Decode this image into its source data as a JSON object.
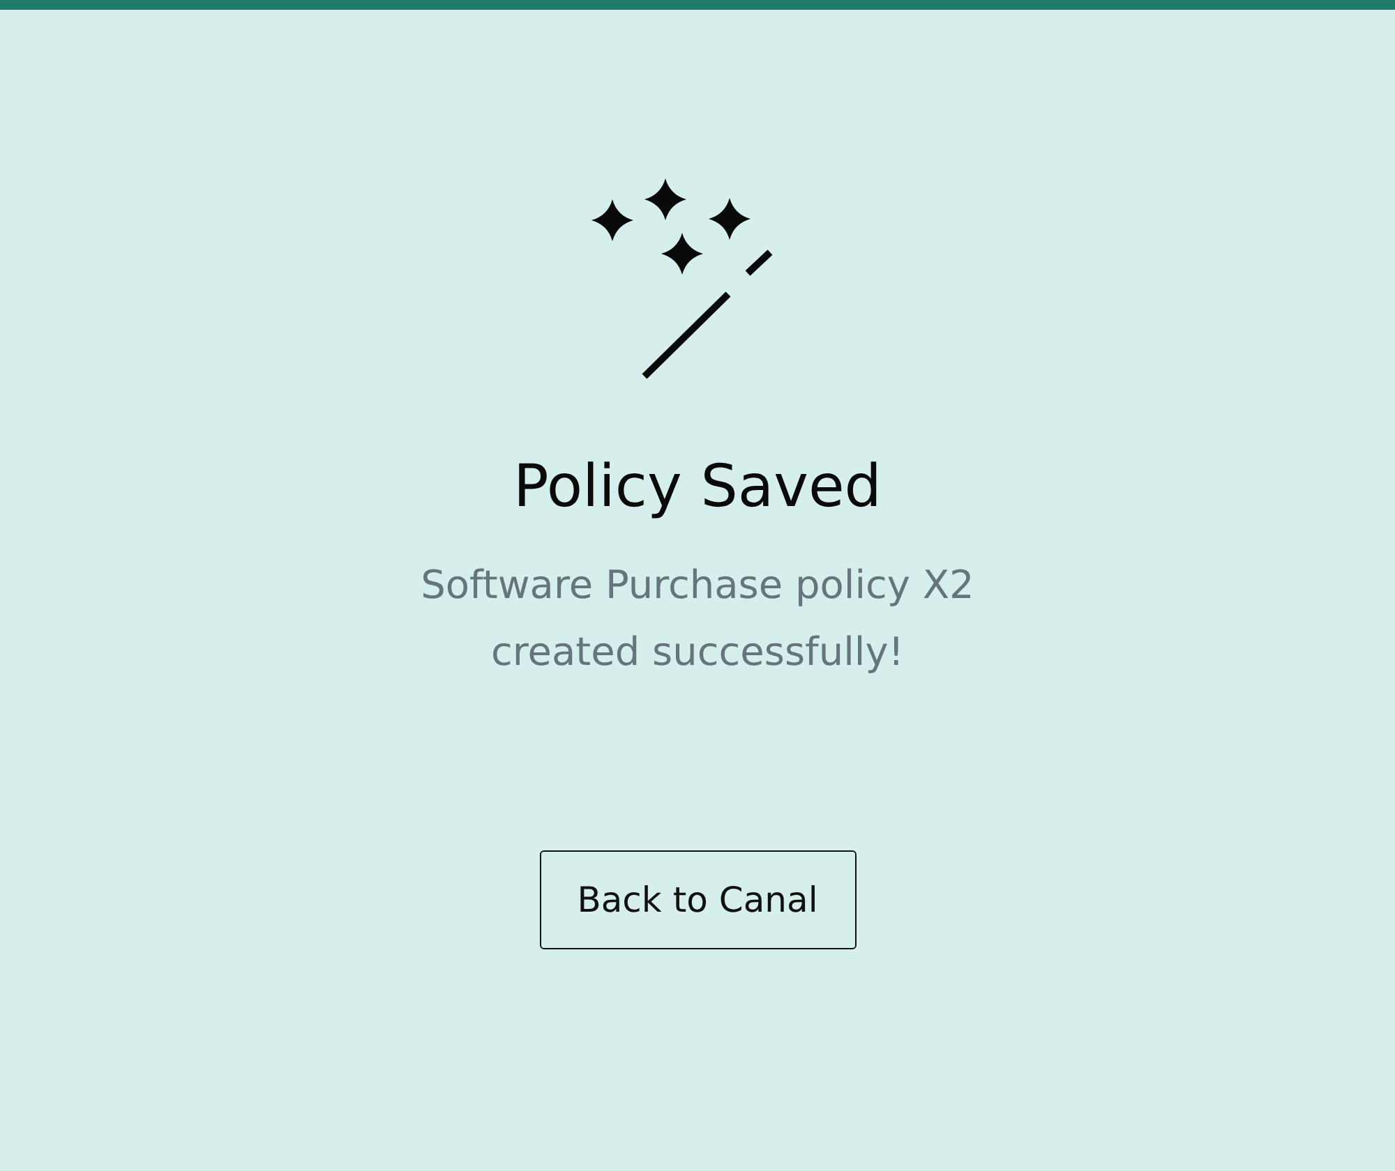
{
  "title": "Policy Saved",
  "message": "Software Purchase policy X2 created successfully!",
  "button": {
    "label": "Back to Canal"
  }
}
